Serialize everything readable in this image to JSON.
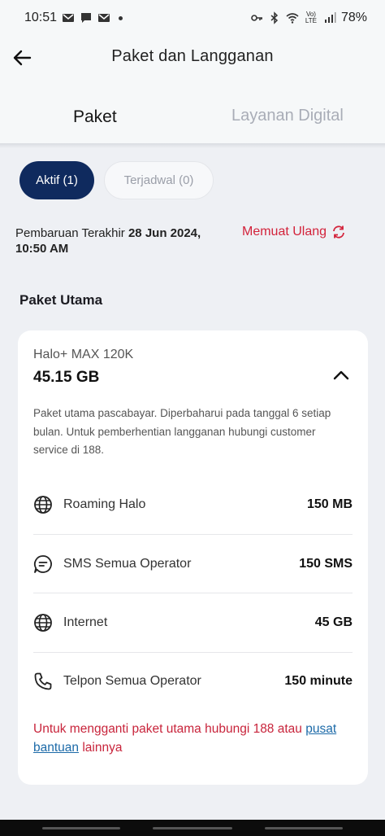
{
  "status_bar": {
    "time": "10:51",
    "battery": "78%",
    "signal_label": "Vo) LTE"
  },
  "header": {
    "title": "Paket dan Langganan",
    "tabs": [
      {
        "label": "Paket",
        "active": true
      },
      {
        "label": "Layanan Digital",
        "active": false
      }
    ]
  },
  "filters": {
    "active_label": "Aktif (1)",
    "scheduled_label": "Terjadwal (0)"
  },
  "update": {
    "prefix": "Pembaruan Terakhir",
    "date": "28 Jun 2024,",
    "time": "10:50 AM",
    "reload_label": "Memuat Ulang"
  },
  "section": {
    "title": "Paket Utama"
  },
  "plan": {
    "name": "Halo+ MAX 120K",
    "size": "45.15 GB",
    "description": "Paket utama pascabayar. Diperbaharui pada tanggal 6 setiap bulan. Untuk pemberhentian langganan hubungi customer service di 188.",
    "items": [
      {
        "icon": "globe-icon",
        "label": "Roaming Halo",
        "value": "150 MB"
      },
      {
        "icon": "chat-icon",
        "label": "SMS Semua Operator",
        "value": "150 SMS"
      },
      {
        "icon": "globe-icon",
        "label": "Internet",
        "value": "45 GB"
      },
      {
        "icon": "phone-icon",
        "label": "Telpon Semua Operator",
        "value": "150 minute"
      }
    ],
    "note_before": "Untuk mengganti paket utama hubungi 188 atau ",
    "note_link": "pusat bantuan",
    "note_after": " lainnya"
  },
  "colors": {
    "primary": "#0f2a5e",
    "accent_red": "#d3223a",
    "link": "#1c6aa8"
  }
}
